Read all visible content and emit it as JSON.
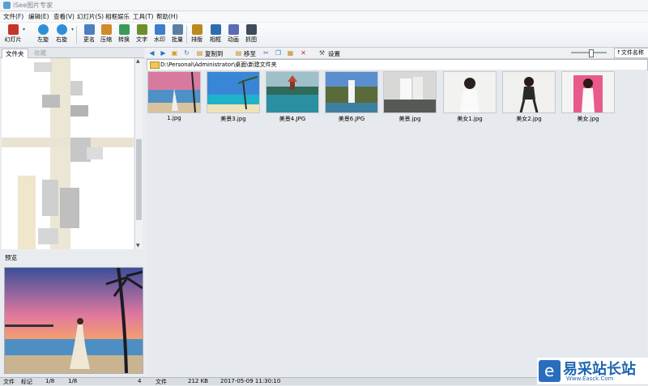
{
  "window": {
    "title": "iSee图片专家"
  },
  "menu": [
    "文件(F)",
    "编辑(E)",
    "查看(V)",
    "幻灯片(S)",
    "相框娱乐",
    "工具(T)",
    "帮助(H)"
  ],
  "toolbar": [
    {
      "label": "幻灯片",
      "icon": "slideshow-icon",
      "color": "#c8342a"
    },
    {
      "label": "左旋",
      "icon": "rotate-left-icon",
      "color": "#2f8fd6"
    },
    {
      "label": "右旋",
      "icon": "rotate-right-icon",
      "color": "#2f8fd6"
    },
    {
      "label": "更名",
      "icon": "rename-icon",
      "color": "#4c7fbf"
    },
    {
      "label": "压缩",
      "icon": "compress-icon",
      "color": "#d08a2a"
    },
    {
      "label": "转换",
      "icon": "convert-icon",
      "color": "#3a9a5a"
    },
    {
      "label": "文字",
      "icon": "text-icon",
      "color": "#6d8f2a"
    },
    {
      "label": "水印",
      "icon": "watermark-icon",
      "color": "#3d7fc9"
    },
    {
      "label": "批量",
      "icon": "batch-icon",
      "color": "#5a7fa3"
    },
    {
      "label": "排版",
      "icon": "layout-icon",
      "color": "#b88a1f"
    },
    {
      "label": "相框",
      "icon": "frame-icon",
      "color": "#2e6cb0"
    },
    {
      "label": "动画",
      "icon": "animation-icon",
      "color": "#5b6bb5"
    },
    {
      "label": "抓图",
      "icon": "capture-icon",
      "color": "#3e4c5c"
    }
  ],
  "left_tabs": [
    "文件夹",
    "收藏"
  ],
  "preview_label": "预览",
  "nav": {
    "copy_to": "复制到",
    "move_to": "移至",
    "settings": "设置",
    "sort": "↑文件名称"
  },
  "path": "D:\\Personal\\Administrator\\桌面\\新建文件夹",
  "thumbnails": [
    {
      "name": "1.jpg"
    },
    {
      "name": "美景3.jpg"
    },
    {
      "name": "美景4.JPG"
    },
    {
      "name": "美景6.JPG"
    },
    {
      "name": "美景.jpg"
    },
    {
      "name": "美女1.jpg"
    },
    {
      "name": "美女2.jpg"
    },
    {
      "name": "美女.jpg"
    }
  ],
  "status": [
    "文件",
    "标记",
    "1/8",
    "1/8",
    "4",
    "文件",
    "212 KB",
    "2017-05-09 11:30:10"
  ],
  "watermark": {
    "text": "易采站长站",
    "url": "Www.Easck.Com"
  }
}
